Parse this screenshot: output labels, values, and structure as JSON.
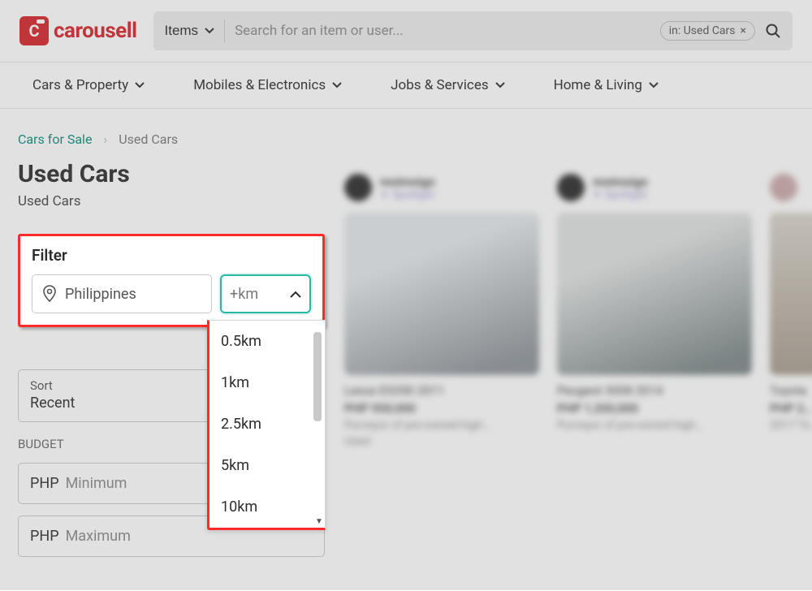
{
  "header": {
    "logo_text": "carousell",
    "items_label": "Items",
    "search_placeholder": "Search for an item or user...",
    "in_chip": "in: Used Cars",
    "in_chip_close": "×"
  },
  "nav": {
    "items": [
      "Cars & Property",
      "Mobiles & Electronics",
      "Jobs & Services",
      "Home & Living"
    ]
  },
  "breadcrumb": {
    "root": "Cars for Sale",
    "sep": "›",
    "current": "Used Cars"
  },
  "page": {
    "title": "Used Cars",
    "subtitle": "Used Cars"
  },
  "filter": {
    "title": "Filter",
    "location_value": "Philippines",
    "km_label": "+km",
    "unit_options": [
      "0.5km",
      "1km",
      "2.5km",
      "5km",
      "10km"
    ]
  },
  "sort": {
    "label": "Sort",
    "value": "Recent"
  },
  "budget": {
    "label": "BUDGET",
    "currency": "PHP",
    "min_placeholder": "Minimum",
    "max_placeholder": "Maximum"
  },
  "listings": [
    {
      "seller": "moimoigo",
      "badge": "Spotlight",
      "title": "Lexus ES350 2011",
      "price": "PHP 950,000",
      "desc": "Purveyor of pre-owned high…",
      "status": "Used"
    },
    {
      "seller": "moimoigo",
      "badge": "Spotlight",
      "title": "Peugeot 3008 2014",
      "price": "PHP 1,200,000",
      "desc": "Purveyor of pre-owned high…",
      "status": ""
    },
    {
      "seller": "",
      "badge": "",
      "title": "Toyota",
      "price": "PHP 2…",
      "desc": "2017 To…",
      "status": ""
    }
  ]
}
